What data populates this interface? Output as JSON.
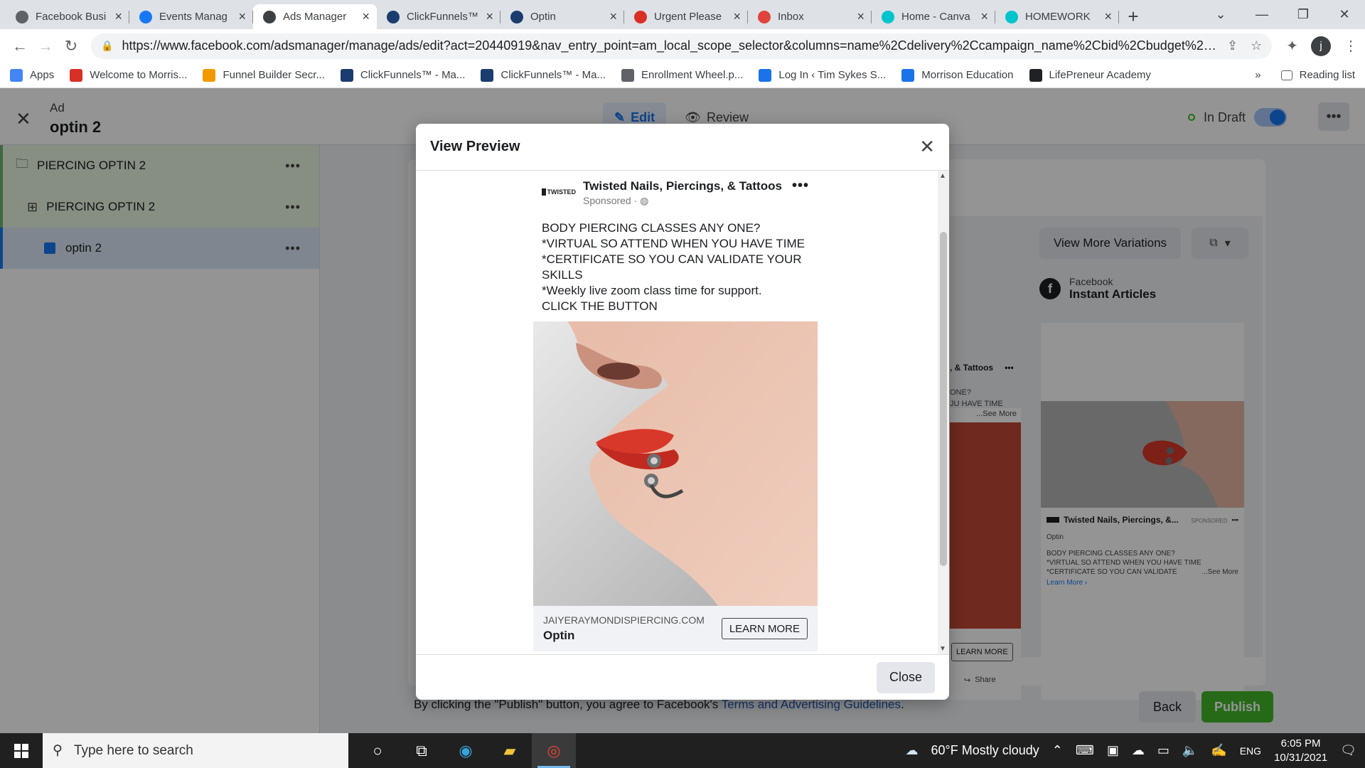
{
  "browser": {
    "tabs": [
      {
        "title": "Facebook Busi",
        "icon": "facebook-business-icon",
        "color": "#5f6368"
      },
      {
        "title": "Events Manag",
        "icon": "facebook-icon",
        "color": "#1877f2"
      },
      {
        "title": "Ads Manager",
        "icon": "ads-manager-icon",
        "color": "#3c4043"
      },
      {
        "title": "ClickFunnels™",
        "icon": "clickfunnels-icon",
        "color": "#1a3c6e"
      },
      {
        "title": "Optin",
        "icon": "clickfunnels-icon",
        "color": "#1a3c6e"
      },
      {
        "title": "Urgent Please",
        "icon": "gmail-icon",
        "color": "#d93025"
      },
      {
        "title": "Inbox",
        "icon": "inbox-icon",
        "color": "#e0443e"
      },
      {
        "title": "Home - Canva",
        "icon": "canva-icon",
        "color": "#00c4cc"
      },
      {
        "title": "HOMEWORK",
        "icon": "canva-icon",
        "color": "#00c4cc"
      }
    ],
    "active_tab_index": 2,
    "url": "https://www.facebook.com/adsmanager/manage/ads/edit?act=20440919&nav_entry_point=am_local_scope_selector&columns=name%2Cdelivery%2Ccampaign_name%2Cbid%2Cbudget%2Clast_...",
    "bookmarks": [
      {
        "label": "Apps",
        "icon": "apps-grid-icon"
      },
      {
        "label": "Welcome to Morris...",
        "icon": "gmail-icon"
      },
      {
        "label": "Funnel Builder Secr...",
        "icon": "funnel-icon"
      },
      {
        "label": "ClickFunnels™ - Ma...",
        "icon": "clickfunnels-icon"
      },
      {
        "label": "ClickFunnels™ - Ma...",
        "icon": "clickfunnels-icon"
      },
      {
        "label": "Enrollment Wheel.p...",
        "icon": "globe-icon"
      },
      {
        "label": "Log In ‹ Tim Sykes S...",
        "icon": "ts-icon"
      },
      {
        "label": "Morrison Education",
        "icon": "gear-icon"
      },
      {
        "label": "LifePreneur Academy",
        "icon": "compass-icon"
      }
    ],
    "bookmarks_overflow": "»",
    "reading_list": "Reading list",
    "profile_initial": "j"
  },
  "app": {
    "kicker": "Ad",
    "ad_name": "optin 2",
    "edit_label": "Edit",
    "review_label": "Review",
    "status_label": "In Draft",
    "tree": [
      {
        "label": "PIERCING OPTIN 2",
        "level": "campaign"
      },
      {
        "label": "PIERCING OPTIN 2",
        "level": "adset"
      },
      {
        "label": "optin 2",
        "level": "ad"
      }
    ],
    "view_more_label": "View More Variations",
    "placement_kicker": "Facebook",
    "placement_name": "Instant Articles",
    "ia_page_name": "Twisted Nails, Piercings, &...",
    "ia_sponsored": "SPONSORED",
    "ia_headline": "Optin",
    "ia_text": "BODY PIERCING CLASSES ANY ONE?\n*VIRTUAL SO ATTEND WHEN YOU HAVE TIME\n*CERTIFICATE SO YOU CAN VALIDATE",
    "ia_see_more": "...See More",
    "ia_learn_more": "Learn More",
    "feed_partial_name": ", & Tattoos",
    "feed_partial_text": "ONE?\nJU HAVE TIME",
    "feed_see_more": "...See More",
    "feed_learn_more": "LEARN MORE",
    "feed_share": "Share",
    "terms_prefix": "By clicking the \"Publish\" button, you agree to Facebook's",
    "terms_link": "Terms and Advertising Guidelines",
    "terms_suffix": ".",
    "back_label": "Back",
    "publish_label": "Publish"
  },
  "modal": {
    "title": "View Preview",
    "page_name": "Twisted Nails, Piercings, & Tattoos",
    "logo_text": "TWISTED",
    "sponsored": "Sponsored ·",
    "body_lines": [
      "BODY PIERCING CLASSES ANY ONE?",
      "*VIRTUAL SO ATTEND WHEN YOU HAVE TIME",
      "*CERTIFICATE SO YOU CAN VALIDATE YOUR SKILLS",
      "*Weekly live zoom class time for support.",
      "CLICK THE BUTTON"
    ],
    "domain": "JAIYERAYMONDISPIERCING.COM",
    "headline": "Optin",
    "cta": "LEARN MORE",
    "close_label": "Close"
  },
  "taskbar": {
    "search_placeholder": "Type here to search",
    "weather": "60°F  Mostly cloudy",
    "language": "ENG",
    "time": "6:05 PM",
    "date": "10/31/2021"
  },
  "colors": {
    "facebook_blue": "#1877f2",
    "publish_green": "#42b72a",
    "lip_red": "#d8382a"
  }
}
